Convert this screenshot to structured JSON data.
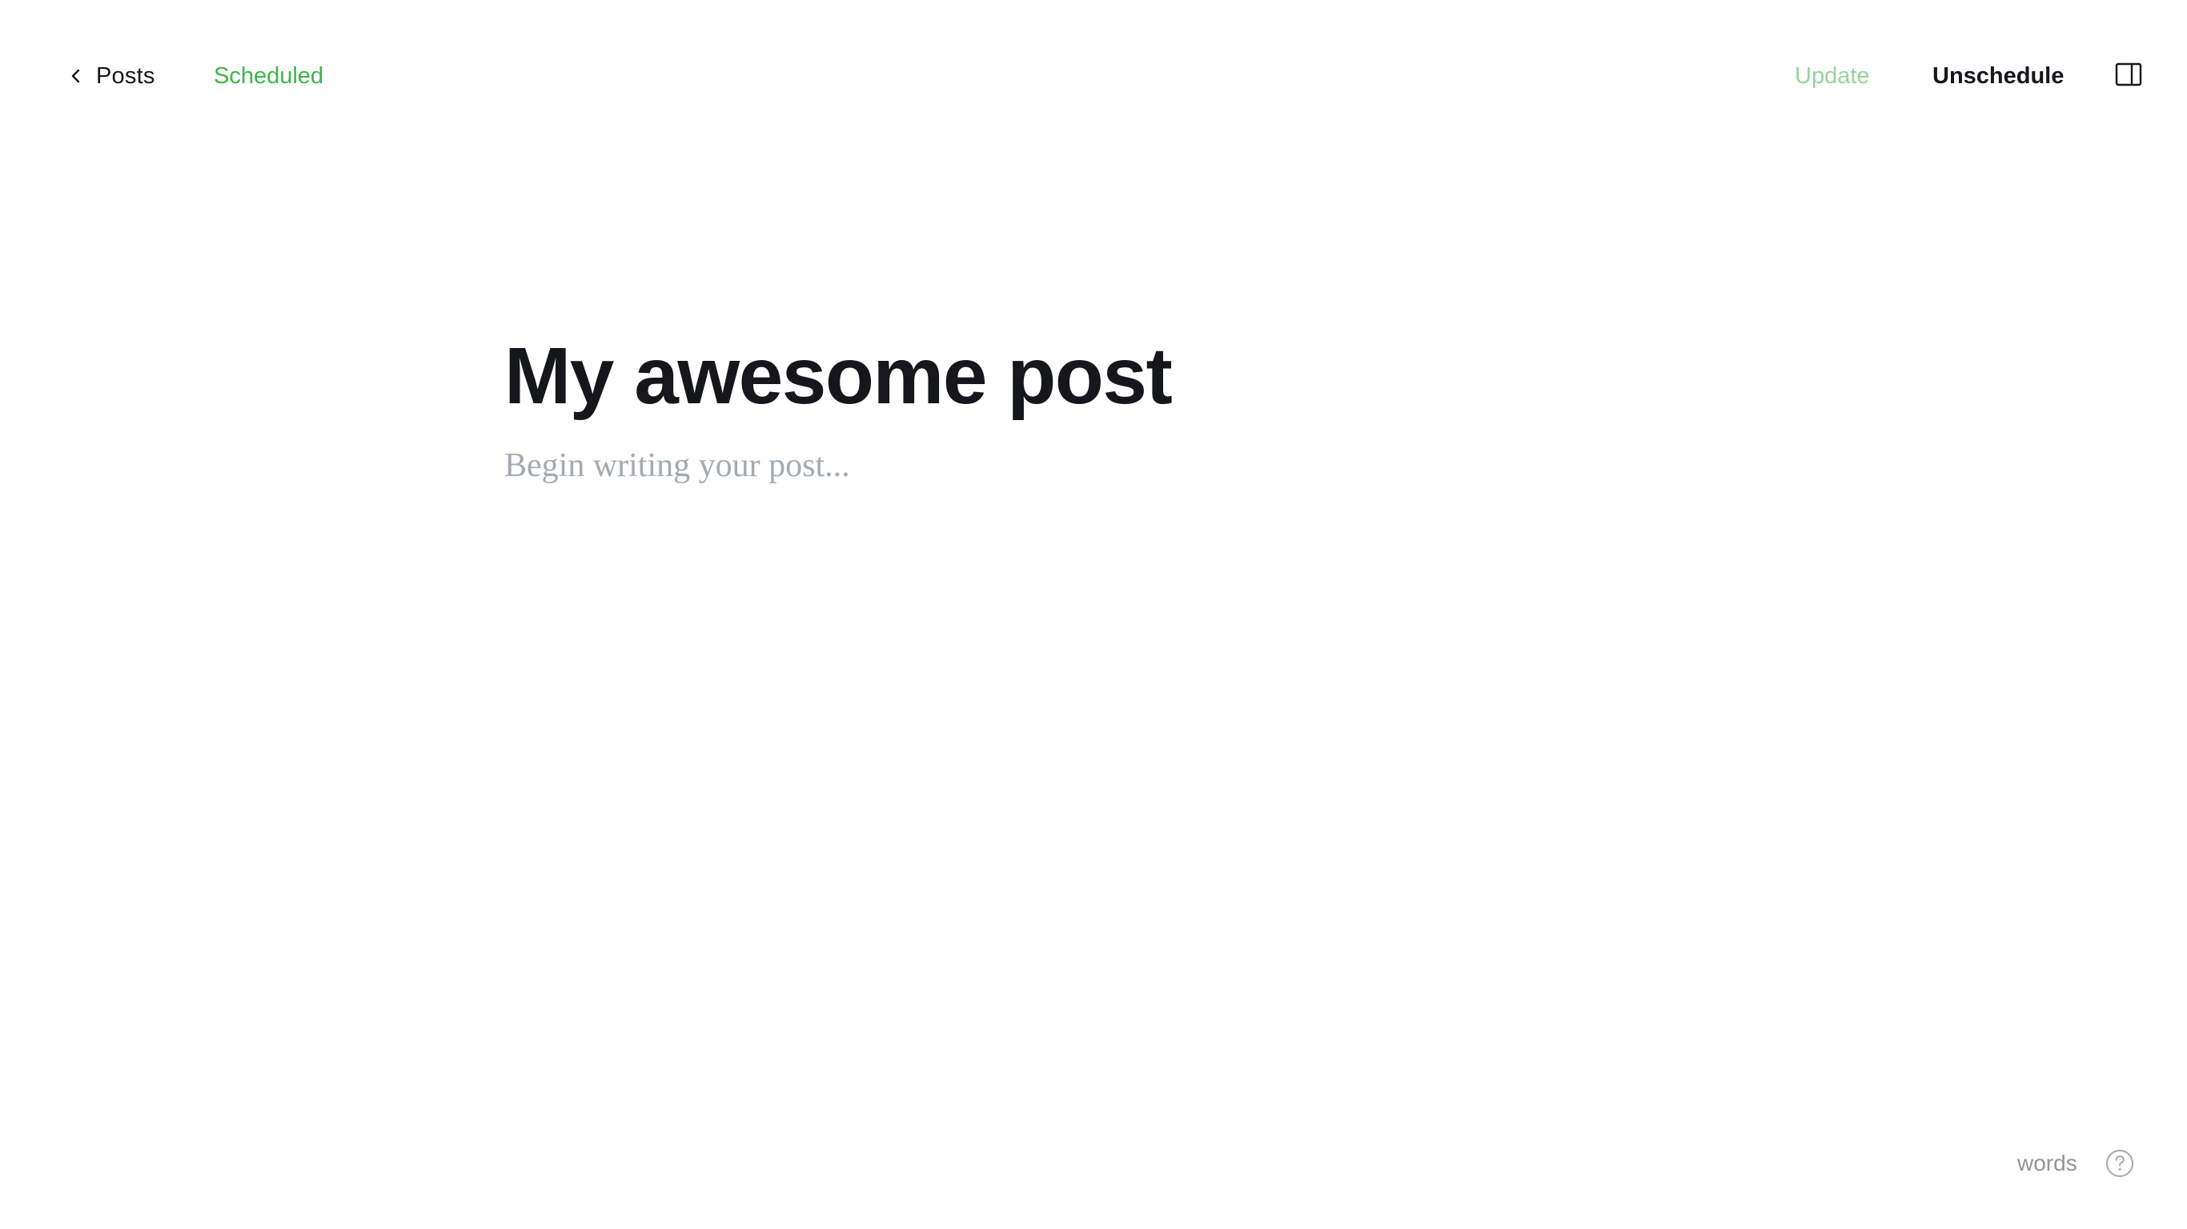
{
  "header": {
    "back_label": "Posts",
    "status_label": "Scheduled",
    "update_label": "Update",
    "unschedule_label": "Unschedule",
    "back_icon": "chevron-left-icon",
    "sidebar_toggle_icon": "sidebar-panel-icon"
  },
  "editor": {
    "title": "My awesome post",
    "body_placeholder": "Begin writing your post..."
  },
  "footer": {
    "word_count_label": "words",
    "help_icon": "question-circle-icon"
  },
  "colors": {
    "accent": "#3eb548",
    "accent_disabled": "#9ad29f",
    "text": "#15171a",
    "placeholder": "#a3aab2",
    "muted": "#8e959c"
  }
}
